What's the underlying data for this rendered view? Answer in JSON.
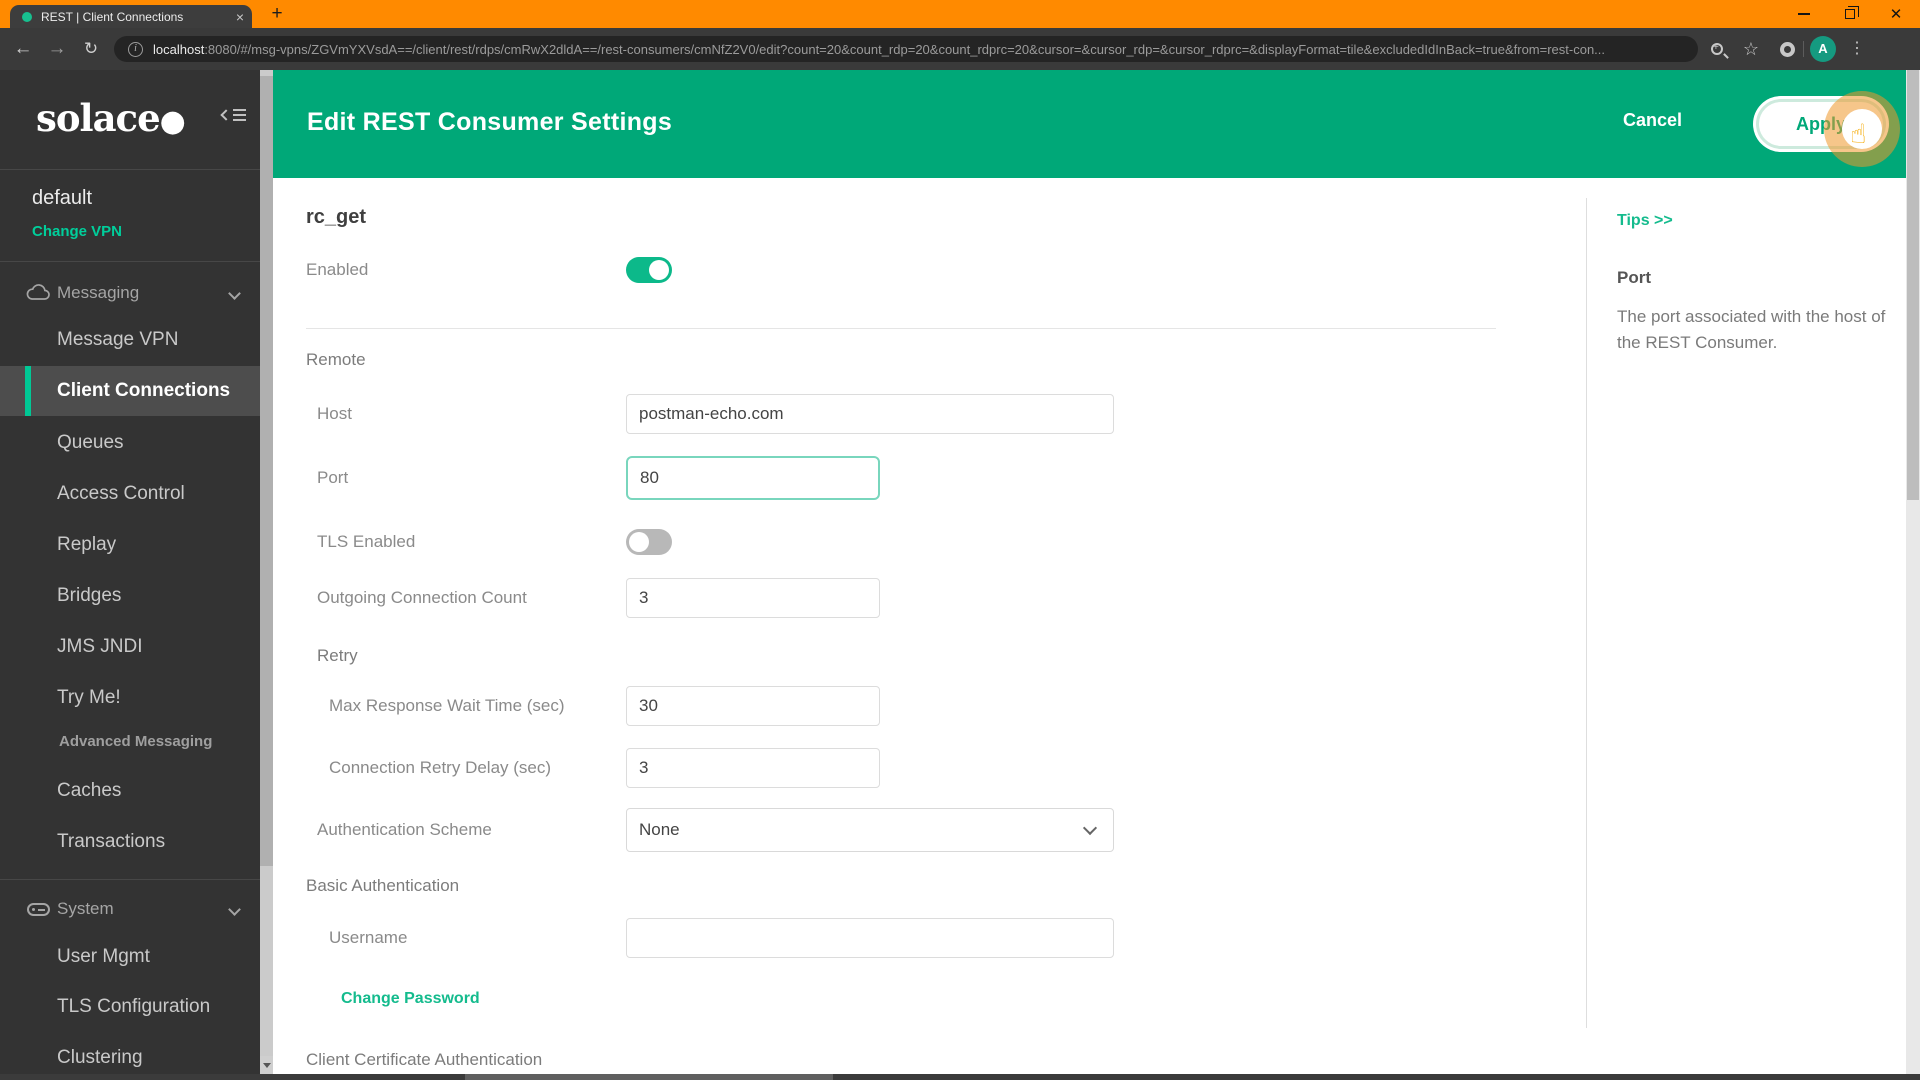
{
  "browser": {
    "tab_title": "REST | Client Connections",
    "new_tab": "+",
    "url_host": "localhost",
    "url_rest": ":8080/#/msg-vpns/ZGVmYXVsdA==/client/rest/rdps/cmRwX2dldA==/rest-consumers/cmNfZ2V0/edit?count=20&count_rdp=20&count_rdprc=20&cursor=&cursor_rdp=&cursor_rdprc=&displayFormat=tile&excludedIdInBack=true&from=rest-con...",
    "avatar_initial": "A",
    "close_glyph": "×",
    "back_glyph": "←",
    "forward_glyph": "→",
    "reload_glyph": "↻",
    "info_glyph": "i",
    "star_glyph": "☆",
    "kebab_glyph": "⋮",
    "wclose_glyph": "✕",
    "titlebar_color": "#FF8A00"
  },
  "sidebar": {
    "logo_text": "solace",
    "logo_dot": "●",
    "vpn_name": "default",
    "change_vpn_label": "Change VPN",
    "messaging_section": "Messaging",
    "system_section": "System",
    "items": [
      {
        "label": "Message VPN"
      },
      {
        "label": "Client Connections",
        "selected": true
      },
      {
        "label": "Queues"
      },
      {
        "label": "Access Control"
      },
      {
        "label": "Replay"
      },
      {
        "label": "Bridges"
      },
      {
        "label": "JMS JNDI"
      },
      {
        "label": "Try Me!"
      },
      {
        "label": "Advanced Messaging",
        "subheader": true
      },
      {
        "label": "Caches"
      },
      {
        "label": "Transactions"
      },
      {
        "label": "User Mgmt"
      },
      {
        "label": "TLS Configuration"
      },
      {
        "label": "Clustering"
      }
    ],
    "bg_color": "#333333",
    "accent_green": "#00C895"
  },
  "header": {
    "title": "Edit REST Consumer Settings",
    "cancel_label": "Cancel",
    "apply_label": "Apply",
    "bg_color": "#00A878"
  },
  "form": {
    "name": "rc_get",
    "enabled_label": "Enabled",
    "enabled_state": "on",
    "remote_section": "Remote",
    "host": {
      "label": "Host",
      "value": "postman-echo.com"
    },
    "port": {
      "label": "Port",
      "value": "80",
      "focused": true
    },
    "tls": {
      "label": "TLS Enabled",
      "state": "off"
    },
    "outgoing": {
      "label": "Outgoing Connection Count",
      "value": "3"
    },
    "retry_section": "Retry",
    "max_wait": {
      "label": "Max Response Wait Time (sec)",
      "value": "30"
    },
    "retry_delay": {
      "label": "Connection Retry Delay (sec)",
      "value": "3"
    },
    "auth_scheme": {
      "label": "Authentication Scheme",
      "value": "None"
    },
    "basic_auth_section": "Basic Authentication",
    "username": {
      "label": "Username",
      "value": ""
    },
    "change_password_label": "Change Password",
    "client_cert_section": "Client Certificate Authentication",
    "focus_border_color": "#79D6BD",
    "toggle_on_color": "#0CB98A"
  },
  "tips": {
    "link_label": "Tips >>",
    "heading": "Port",
    "body": "The port associated with the host of the REST Consumer.",
    "link_color": "#14BB8D"
  }
}
